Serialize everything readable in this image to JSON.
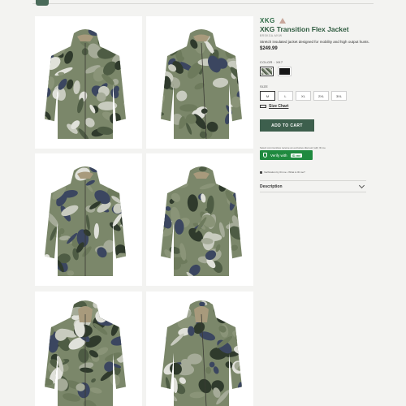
{
  "product": {
    "brand": "XKG",
    "title": "XKG Transition Flex Jacket",
    "sku": "BRSKGA-MVW",
    "description": "Stretch insulated jacket designed for mobility and high output hunts.",
    "price": "$249.99"
  },
  "color": {
    "label": "COLOR : XK7",
    "swatches": [
      {
        "name": "XK7 camo",
        "selected": true,
        "color": "#8a9486"
      },
      {
        "name": "Black",
        "selected": false,
        "color": "#161616"
      }
    ]
  },
  "size": {
    "label": "SIZE",
    "options": [
      "M",
      "L",
      "XL",
      "2XL",
      "3XL"
    ],
    "selected": "M"
  },
  "size_chart": {
    "label": "Size Chart"
  },
  "add_to_cart": {
    "label": "ADD TO CART"
  },
  "verification": {
    "note": "Select communities receive an exclusive discount with ID.me",
    "button_label": "Verify with",
    "idme_label": "ID.me",
    "verified_by": "Verification by ID.me • What is ID.me?"
  },
  "accordion": {
    "description_label": "Description"
  },
  "gallery": {
    "images": [
      {
        "view": "front"
      },
      {
        "view": "side-left"
      },
      {
        "view": "side-right"
      },
      {
        "view": "back"
      },
      {
        "view": "front-hood"
      },
      {
        "view": "side-hood"
      }
    ]
  },
  "colors": {
    "accent": "#3d5f4d",
    "brand": "#2d6a45",
    "verify": "#1f8a3f"
  }
}
